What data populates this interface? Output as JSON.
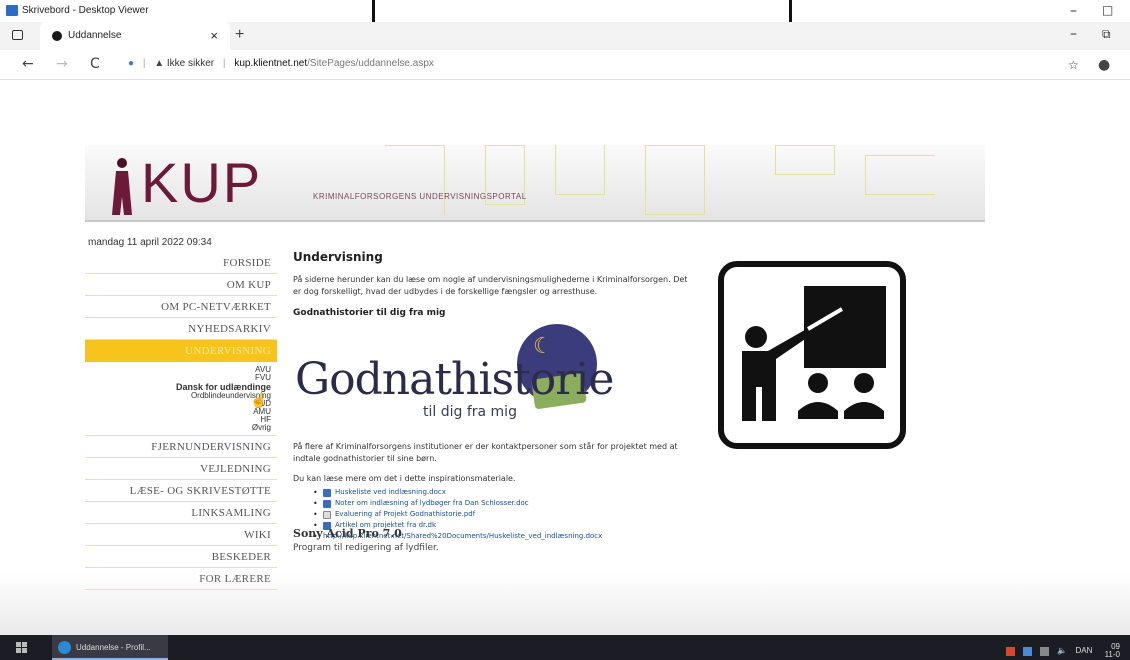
{
  "viewer": {
    "title": "Skrivebord - Desktop Viewer",
    "share_bar": "..... ▾ ....."
  },
  "window_controls": {
    "minimize": "–",
    "maximize": "□",
    "restore": "⧉"
  },
  "browser": {
    "tab_title": "Uddannelse",
    "tab_close": "×",
    "new_tab": "+",
    "nav": {
      "back": "←",
      "forward": "→",
      "reload": "C"
    },
    "security_warning": "Ikke sikker",
    "url_host": "kup.klientnet.net",
    "url_path": "/SitePages/uddannelse.aspx"
  },
  "site": {
    "logo": "KUP",
    "portal_name": "KRIMINALFORSORGENS UNDERVISNINGSPORTAL",
    "date": "mandag 11 april 2022 09:34"
  },
  "nav": {
    "items_top": [
      "FORSIDE",
      "OM KUP",
      "OM PC-NETVÆRKET",
      "NYHEDSARKIV"
    ],
    "active": "UNDERVISNING",
    "sub_items": [
      "AVU",
      "FVU",
      "Dansk for udlændinge",
      "Ordblindeundervisning",
      "EUD",
      "AMU",
      "HF",
      "Øvrig"
    ],
    "items_bottom": [
      "FJERNUNDERVISNING",
      "VEJLEDNING",
      "LÆSE- OG SKRIVESTØTTE",
      "LINKSAMLING",
      "WIKI",
      "BESKEDER",
      "FOR LÆRERE"
    ]
  },
  "main": {
    "heading": "Undervisning",
    "intro": "På siderne herunder kan du læse om nogle af undervisningsmulighederne i Kriminalforsorgen. Det er dog forskelligt, hvad der udbydes i de forskellige fængsler og arresthuse.",
    "subheading": "Godnathistorier til dig fra mig",
    "image_title": "Godnathistorie",
    "image_subtitle": "til dig fra mig",
    "body": "På flere af Kriminalforsorgens institutioner er der kontaktpersoner som står for projektet med at indtale godnathistorier til sine børn.",
    "more": "Du kan læse mere om det i dette inspirationsmateriale.",
    "links": [
      "Huskeliste ved indlæsning.docx",
      "Noter om indlæsning af lydbøger fra Dan Schlosser.doc",
      "Evaluering af Projekt Godnathistorie.pdf",
      "Artikel om projektet fra dr.dk",
      "http://kup.klientnet.net/Shared%20Documents/Huskeliste_ved_indlæsning.docx"
    ],
    "sony_title": "Sony Acid Pro 7.0",
    "sony_sub": "Program til redigering af lydfiler."
  },
  "taskbar": {
    "app_label": "Uddannelse - Profil...",
    "lang": "DAN",
    "time": "09",
    "date": "11-0"
  },
  "colors": {
    "accent": "#f6c41b",
    "brand": "#6d1a3a",
    "link": "#1a4fa6"
  }
}
